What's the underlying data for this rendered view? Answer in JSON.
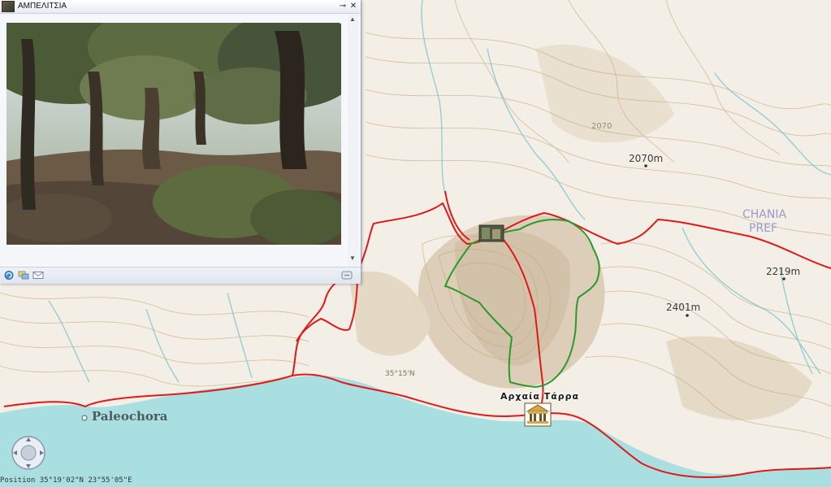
{
  "popup": {
    "title": "ΑΜΠΕΛΙΤΣΙΑ",
    "pin_icon": "pin-icon",
    "close_icon": "close-icon"
  },
  "map": {
    "labels": {
      "peak_top": "2070",
      "peak_1": "2070m",
      "peak_2": "2219m",
      "peak_3": "2401m",
      "region_line1": "CHANIA",
      "region_line2": "PREF",
      "town": "Paleochora",
      "site": "Αρχαία Τάρρα",
      "graticule": "35°15'N"
    },
    "colors": {
      "sea": "#a9dfe0",
      "land": "#f4efe6",
      "contour": "#c9a97a",
      "river": "#7fc4cc",
      "road": "#e01818",
      "route": "#2a9a2a",
      "relief": "#c9b494"
    }
  },
  "status": {
    "text": "Position 35°19'02\"N  23°55'05\"E"
  },
  "icons": {
    "nav": "pan-navigation-icon",
    "temple": "temple-icon",
    "photo_marker": "photo-marker-icon"
  }
}
